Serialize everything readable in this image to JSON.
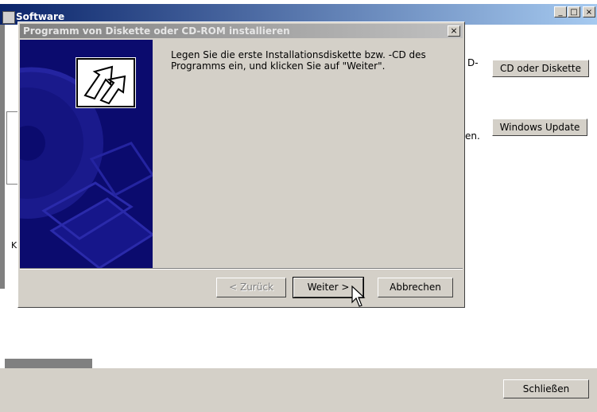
{
  "background_window": {
    "title": "Software",
    "buttons": {
      "minimize": "_",
      "maximize": "□",
      "close": "×",
      "cd_diskette": "CD oder Diskette",
      "windows_update": "Windows Update",
      "close_main": "Schließen"
    },
    "fragments": {
      "d_dash": "D-",
      "en_dot": "en.",
      "k": "K"
    }
  },
  "dialog": {
    "title": "Programm von Diskette oder CD-ROM installieren",
    "close": "×",
    "message_line1": "Legen Sie die erste Installationsdiskette bzw. -CD des",
    "message_line2": "Programms ein, und klicken Sie auf \"Weiter\".",
    "buttons": {
      "back": "< Zurück",
      "next": "Weiter >",
      "cancel": "Abbrechen"
    }
  },
  "colors": {
    "active_title_start": "#0a246a",
    "active_title_end": "#a6caf0",
    "inactive_title_start": "#808080",
    "inactive_title_end": "#c0c0c0",
    "art_background": "#0b0b6e",
    "face": "#d4d0c8"
  }
}
